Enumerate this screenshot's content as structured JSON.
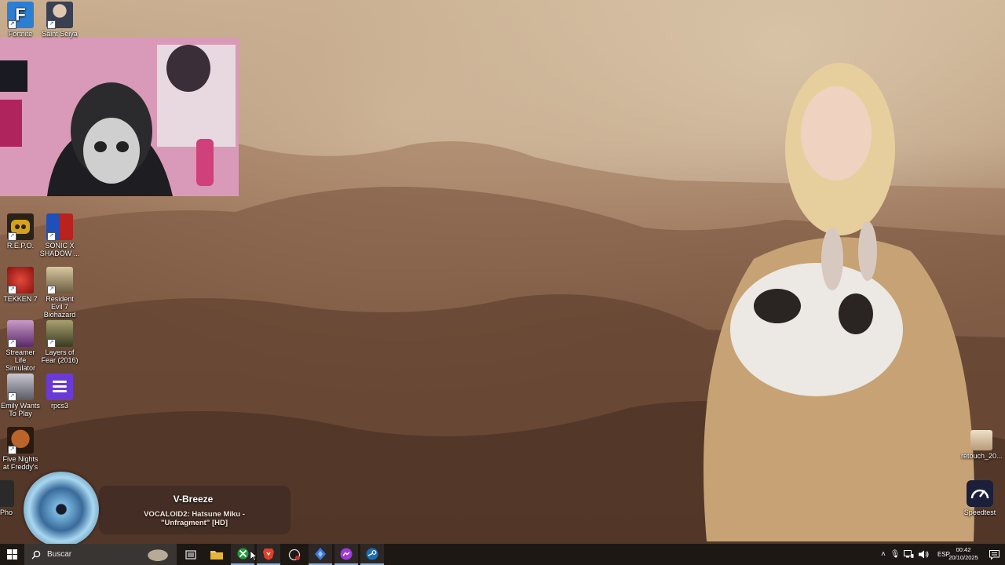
{
  "desktop": {
    "icons": [
      {
        "label": "Fortnite",
        "icon": "fortnite-icon",
        "color": "#2a7fd4"
      },
      {
        "label": "Saint Seiya",
        "icon": "saint-seiya-icon",
        "color": "#3a3f52"
      },
      {
        "label": "R.E.P.O.",
        "icon": "repo-icon",
        "color": "#d6a21a"
      },
      {
        "label": "SONIC X SHADOW ...",
        "icon": "sonic-icon",
        "color": "#1f4fb8"
      },
      {
        "label": "TEKKEN 7",
        "icon": "tekken-icon",
        "color": "#b01e1e"
      },
      {
        "label": "Resident Evil 7 Biohazard",
        "icon": "resident-evil-icon",
        "color": "#8a7a5a"
      },
      {
        "label": "Streamer Life Simulator",
        "icon": "streamer-life-icon",
        "color": "#7a4a8a"
      },
      {
        "label": "Layers of Fear (2016)",
        "icon": "layers-of-fear-icon",
        "color": "#5a5a3a"
      },
      {
        "label": "Emily Wants To Play",
        "icon": "emily-icon",
        "color": "#9a9aa6"
      },
      {
        "label": "rpcs3",
        "icon": "rpcs3-icon",
        "color": "#6a3ad6"
      },
      {
        "label": "Five Nights at Freddy's",
        "icon": "fnaf-icon",
        "color": "#8a4a1a"
      },
      {
        "label": "Pho",
        "icon": "pho-icon",
        "color": "#2a2a2a"
      },
      {
        "label": "retouch_20...",
        "icon": "image-file-icon",
        "color": "#d8c8b0"
      },
      {
        "label": "Speedtest",
        "icon": "speedtest-icon",
        "color": "#1b1f3a"
      }
    ]
  },
  "now_playing": {
    "artist": "V-Breeze",
    "title": "VOCALOID2: Hatsune Miku - \"Unfragment\" [HD]"
  },
  "taskbar": {
    "search_placeholder": "Buscar",
    "pinned": [
      "start-icon",
      "search-icon",
      "decor-sloth-icon",
      "task-view-icon",
      "file-explorer-icon",
      "xbox-icon",
      "brave-icon",
      "app-circle-icon",
      "blue-app-icon",
      "messenger-icon",
      "steam-icon"
    ],
    "tray": {
      "language": "ESP",
      "time": "00:42",
      "date": "20/10/2025"
    }
  },
  "colors": {
    "taskbar": "#1a1614",
    "accent": "#7fb2e8",
    "xbox": "#1e9e3a",
    "brave": "#e0402a",
    "steam": "#1b6fb8"
  }
}
